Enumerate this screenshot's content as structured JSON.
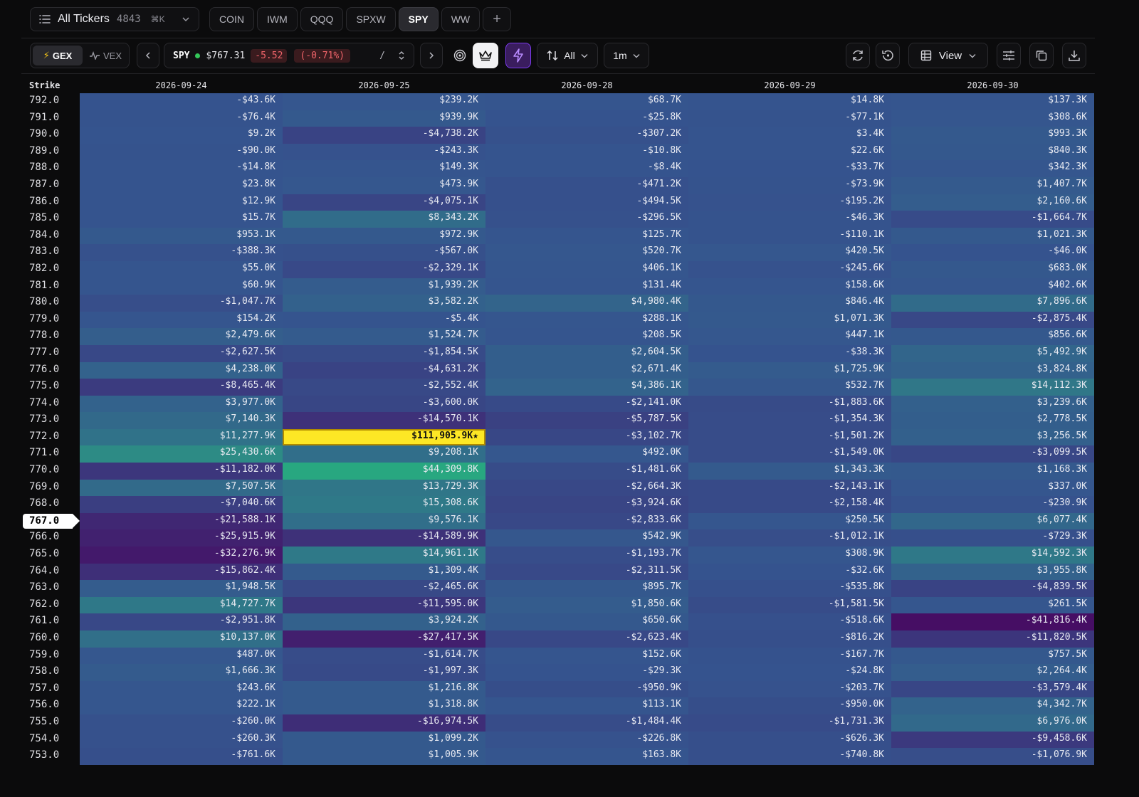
{
  "tickerbar": {
    "all_label": "All Tickers",
    "count": "4843",
    "shortcut": "⌘K",
    "tabs": [
      {
        "label": "COIN",
        "active": false
      },
      {
        "label": "IWM",
        "active": false
      },
      {
        "label": "QQQ",
        "active": false
      },
      {
        "label": "SPXW",
        "active": false
      },
      {
        "label": "SPY",
        "active": true
      },
      {
        "label": "WW",
        "active": false
      }
    ],
    "add_label": "+"
  },
  "toolbar": {
    "gex_label": "GEX",
    "vex_label": "VEX",
    "quote": {
      "symbol": "SPY",
      "price": "$767.31",
      "change": "-5.52",
      "pct": "(-0.71%)",
      "separator": "/"
    },
    "filter_label": "All",
    "timeframe_label": "1m",
    "view_label": "View"
  },
  "colors": {
    "accent_purple": "#7c3aed",
    "positive_peak": "#2ab07f",
    "negative_peak": "#440154",
    "highlight": "#fde725",
    "price_down": "#f0646a",
    "live_dot": "#34c759"
  },
  "grid": {
    "strike_header": "Strike",
    "current_strike": "767.0",
    "dates": [
      "2026-09-24",
      "2026-09-25",
      "2026-09-28",
      "2026-09-29",
      "2026-09-30"
    ],
    "highlight": {
      "strike": "772.0",
      "date": "2026-09-25"
    },
    "rows": [
      {
        "strike": "792.0",
        "values": [
          "-$43.6K",
          "$239.2K",
          "$68.7K",
          "$14.8K",
          "$137.3K"
        ]
      },
      {
        "strike": "791.0",
        "values": [
          "-$76.4K",
          "$939.9K",
          "-$25.8K",
          "-$77.1K",
          "$308.6K"
        ]
      },
      {
        "strike": "790.0",
        "values": [
          "$9.2K",
          "-$4,738.2K",
          "-$307.2K",
          "$3.4K",
          "$993.3K"
        ]
      },
      {
        "strike": "789.0",
        "values": [
          "-$90.0K",
          "-$243.3K",
          "-$10.8K",
          "$22.6K",
          "$840.3K"
        ]
      },
      {
        "strike": "788.0",
        "values": [
          "-$14.8K",
          "$149.3K",
          "-$8.4K",
          "-$33.7K",
          "$342.3K"
        ]
      },
      {
        "strike": "787.0",
        "values": [
          "$23.8K",
          "$473.9K",
          "-$471.2K",
          "-$73.9K",
          "$1,407.7K"
        ]
      },
      {
        "strike": "786.0",
        "values": [
          "$12.9K",
          "-$4,075.1K",
          "-$494.5K",
          "-$195.2K",
          "$2,160.6K"
        ]
      },
      {
        "strike": "785.0",
        "values": [
          "$15.7K",
          "$8,343.2K",
          "-$296.5K",
          "-$46.3K",
          "-$1,664.7K"
        ]
      },
      {
        "strike": "784.0",
        "values": [
          "$953.1K",
          "$972.9K",
          "$125.7K",
          "-$110.1K",
          "$1,021.3K"
        ]
      },
      {
        "strike": "783.0",
        "values": [
          "-$388.3K",
          "-$567.0K",
          "$520.7K",
          "$420.5K",
          "-$46.0K"
        ]
      },
      {
        "strike": "782.0",
        "values": [
          "$55.0K",
          "-$2,329.1K",
          "$406.1K",
          "-$245.6K",
          "$683.0K"
        ]
      },
      {
        "strike": "781.0",
        "values": [
          "$60.9K",
          "$1,939.2K",
          "$131.4K",
          "$158.6K",
          "$402.6K"
        ]
      },
      {
        "strike": "780.0",
        "values": [
          "-$1,047.7K",
          "$3,582.2K",
          "$4,980.4K",
          "$846.4K",
          "$7,896.6K"
        ]
      },
      {
        "strike": "779.0",
        "values": [
          "$154.2K",
          "-$5.4K",
          "$288.1K",
          "$1,071.3K",
          "-$2,875.4K"
        ]
      },
      {
        "strike": "778.0",
        "values": [
          "$2,479.6K",
          "$1,524.7K",
          "$208.5K",
          "$447.1K",
          "$856.6K"
        ]
      },
      {
        "strike": "777.0",
        "values": [
          "-$2,627.5K",
          "-$1,854.5K",
          "$2,604.5K",
          "-$38.3K",
          "$5,492.9K"
        ]
      },
      {
        "strike": "776.0",
        "values": [
          "$4,238.0K",
          "-$4,631.2K",
          "$2,671.4K",
          "$1,725.9K",
          "$3,824.8K"
        ]
      },
      {
        "strike": "775.0",
        "values": [
          "-$8,465.4K",
          "-$2,552.4K",
          "$4,386.1K",
          "$532.7K",
          "$14,112.3K"
        ]
      },
      {
        "strike": "774.0",
        "values": [
          "$3,977.0K",
          "-$3,600.0K",
          "-$2,141.0K",
          "-$1,883.6K",
          "$3,239.6K"
        ]
      },
      {
        "strike": "773.0",
        "values": [
          "$7,140.3K",
          "-$14,570.1K",
          "-$5,787.5K",
          "-$1,354.3K",
          "$2,778.5K"
        ]
      },
      {
        "strike": "772.0",
        "values": [
          "$11,277.9K",
          "$111,905.9K★",
          "-$3,102.7K",
          "-$1,501.2K",
          "$3,256.5K"
        ]
      },
      {
        "strike": "771.0",
        "values": [
          "$25,430.6K",
          "$9,208.1K",
          "$492.0K",
          "-$1,549.0K",
          "-$3,099.5K"
        ]
      },
      {
        "strike": "770.0",
        "values": [
          "-$11,182.0K",
          "$44,309.8K",
          "-$1,481.6K",
          "$1,343.3K",
          "$1,168.3K"
        ]
      },
      {
        "strike": "769.0",
        "values": [
          "$7,507.5K",
          "$13,729.3K",
          "-$2,664.3K",
          "-$2,143.1K",
          "$337.0K"
        ]
      },
      {
        "strike": "768.0",
        "values": [
          "-$7,040.6K",
          "$15,308.6K",
          "-$3,924.6K",
          "-$2,158.4K",
          "-$230.9K"
        ]
      },
      {
        "strike": "767.0",
        "values": [
          "-$21,588.1K",
          "$9,576.1K",
          "-$2,833.6K",
          "$250.5K",
          "$6,077.4K"
        ]
      },
      {
        "strike": "766.0",
        "values": [
          "-$25,915.9K",
          "-$14,589.9K",
          "$542.9K",
          "-$1,012.1K",
          "-$729.3K"
        ]
      },
      {
        "strike": "765.0",
        "values": [
          "-$32,276.9K",
          "$14,961.1K",
          "-$1,193.7K",
          "$308.9K",
          "$14,592.3K"
        ]
      },
      {
        "strike": "764.0",
        "values": [
          "-$15,862.4K",
          "$1,309.4K",
          "-$2,311.5K",
          "-$32.6K",
          "$3,955.8K"
        ]
      },
      {
        "strike": "763.0",
        "values": [
          "$1,948.5K",
          "-$2,465.6K",
          "$895.7K",
          "-$535.8K",
          "-$4,839.5K"
        ]
      },
      {
        "strike": "762.0",
        "values": [
          "$14,727.7K",
          "-$11,595.0K",
          "$1,850.6K",
          "-$1,581.5K",
          "$261.5K"
        ]
      },
      {
        "strike": "761.0",
        "values": [
          "-$2,951.8K",
          "$3,924.2K",
          "$650.6K",
          "-$518.6K",
          "-$41,816.4K"
        ]
      },
      {
        "strike": "760.0",
        "values": [
          "$10,137.0K",
          "-$27,417.5K",
          "-$2,623.4K",
          "-$816.2K",
          "-$11,820.5K"
        ]
      },
      {
        "strike": "759.0",
        "values": [
          "$487.0K",
          "-$1,614.7K",
          "$152.6K",
          "-$167.7K",
          "$757.5K"
        ]
      },
      {
        "strike": "758.0",
        "values": [
          "$1,666.3K",
          "-$1,997.3K",
          "-$29.3K",
          "-$24.8K",
          "$2,264.4K"
        ]
      },
      {
        "strike": "757.0",
        "values": [
          "$243.6K",
          "$1,216.8K",
          "-$950.9K",
          "-$203.7K",
          "-$3,579.4K"
        ]
      },
      {
        "strike": "756.0",
        "values": [
          "$222.1K",
          "$1,318.8K",
          "$113.1K",
          "-$950.0K",
          "$4,342.7K"
        ]
      },
      {
        "strike": "755.0",
        "values": [
          "-$260.0K",
          "-$16,974.5K",
          "-$1,484.4K",
          "-$1,731.3K",
          "$6,976.0K"
        ]
      },
      {
        "strike": "754.0",
        "values": [
          "-$260.3K",
          "$1,099.2K",
          "-$226.8K",
          "-$626.3K",
          "-$9,458.6K"
        ]
      },
      {
        "strike": "753.0",
        "values": [
          "-$761.6K",
          "$1,005.9K",
          "$163.8K",
          "-$740.8K",
          "-$1,076.9K"
        ]
      }
    ]
  }
}
